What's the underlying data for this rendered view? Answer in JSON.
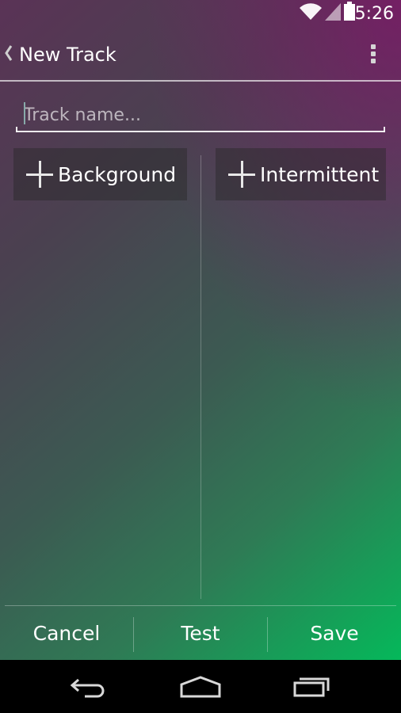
{
  "status_bar": {
    "time": "5:26",
    "icons": [
      "wifi-icon",
      "signal-icon",
      "battery-icon"
    ]
  },
  "action_bar": {
    "back_icon": "chevron-left-icon",
    "title": "New Track",
    "menu_icon": "overflow-menu-icon"
  },
  "track_name": {
    "value": "",
    "placeholder": "Track name..."
  },
  "add_buttons": {
    "background_label": "Background",
    "intermittent_label": "Intermittent",
    "icon": "plus-icon"
  },
  "bottom_bar": {
    "cancel_label": "Cancel",
    "test_label": "Test",
    "save_label": "Save"
  },
  "nav_bar": {
    "icons": [
      "back-arrow-icon",
      "home-icon",
      "recent-apps-icon"
    ]
  },
  "colors": {
    "accent_top_right": "#8c0a6e",
    "accent_bottom_left": "#05b85a",
    "text": "#ffffff"
  }
}
